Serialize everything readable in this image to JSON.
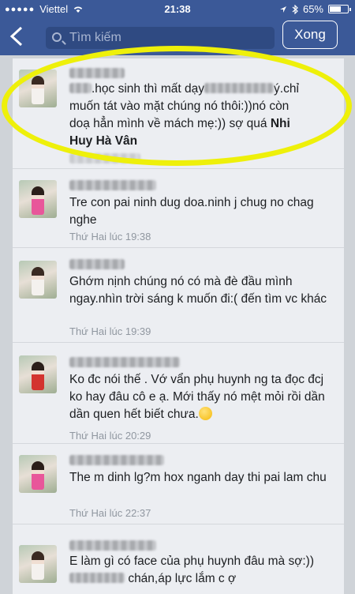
{
  "status_bar": {
    "carrier": "Viettel",
    "time": "21:38",
    "battery": "65%",
    "battery_level": 0.65,
    "signal_dots": "●●●●●"
  },
  "nav": {
    "back_icon": "chevron-left-icon",
    "search_placeholder": "Tìm kiếm",
    "done_label": "Xong"
  },
  "messages": [
    {
      "line1": ".học sinh thì mất dạy",
      "line1_end": "ý.chỉ",
      "line2": "muốn tát vào mặt chúng nó thôi:))nó còn",
      "line3": "doạ hẳn mình về mách mẹ:)) sợ quá ",
      "tag": "Nhi",
      "line4": "Huy Hà Vân",
      "time": ""
    },
    {
      "text": "Tre con pai ninh dug doa.ninh j chug no chag nghe",
      "time": "Thứ Hai lúc 19:38"
    },
    {
      "text": "Ghớm nịnh chúng nó có mà đè đầu mình ngay.nhìn trời sáng k muốn đi:( đến tìm vc khác",
      "time": "Thứ Hai lúc 19:39"
    },
    {
      "text": "Ko đc nói thế . Vớ vẩn phụ huynh ng ta đọc đcj ko hay đâu cô e ạ. Mới thấy nó mệt mỏi rồi dần dần quen hết biết chưa.",
      "time": "Thứ Hai lúc 20:29"
    },
    {
      "text": "The m dinh lg?m hox nganh day thi pai lam chu",
      "time": "Thứ Hai lúc 22:37"
    },
    {
      "line1": "E làm gì có face của phụ huynh đâu mà sợ:))",
      "line2": "chán,áp lực lắm c ợ",
      "time": ""
    }
  ]
}
